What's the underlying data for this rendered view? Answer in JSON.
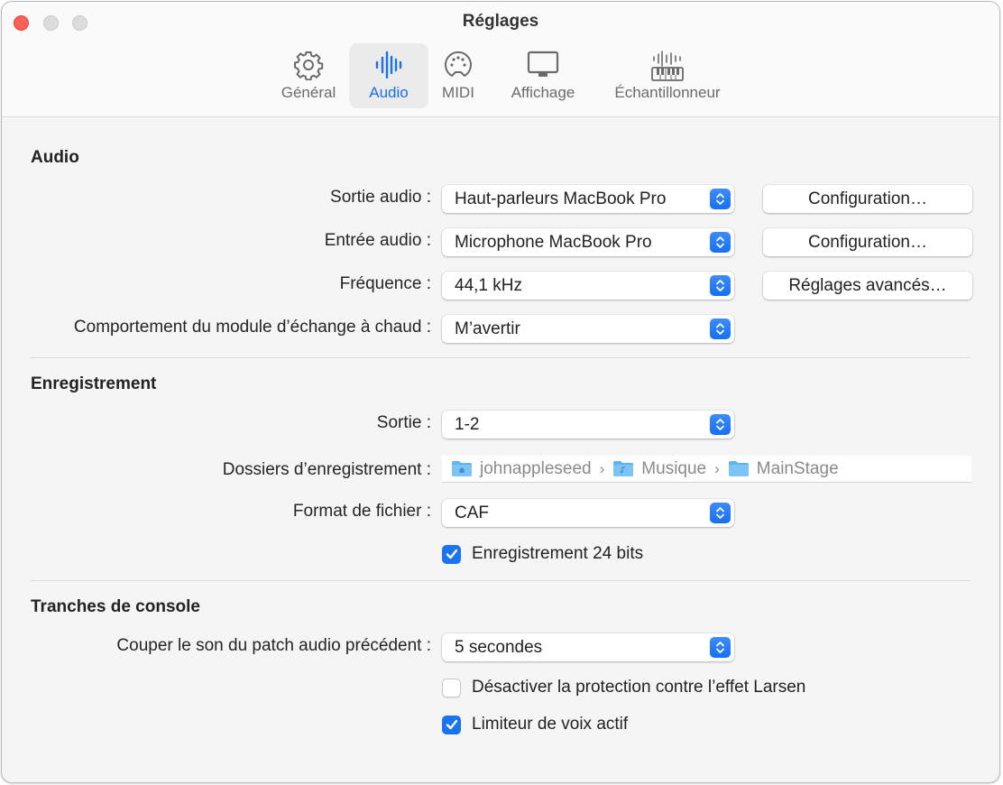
{
  "window": {
    "title": "Réglages",
    "controls": [
      "close",
      "minimize",
      "zoom"
    ]
  },
  "tabs": [
    {
      "label": "Général",
      "icon": "gear-icon",
      "active": false
    },
    {
      "label": "Audio",
      "icon": "waveform-icon",
      "active": true
    },
    {
      "label": "MIDI",
      "icon": "midi-port-icon",
      "active": false
    },
    {
      "label": "Affichage",
      "icon": "display-icon",
      "active": false
    },
    {
      "label": "Échantillonneur",
      "icon": "sampler-keyboard-icon",
      "active": false
    }
  ],
  "accent_color": "#1a73ef",
  "sections": {
    "audio": {
      "title": "Audio",
      "output": {
        "label": "Sortie audio :",
        "value": "Haut-parleurs MacBook Pro",
        "button": "Configuration…"
      },
      "input": {
        "label": "Entrée audio :",
        "value": "Microphone MacBook Pro",
        "button": "Configuration…"
      },
      "frequency": {
        "label": "Fréquence :",
        "value": "44,1 kHz",
        "button": "Réglages avancés…"
      },
      "hotplug": {
        "label": "Comportement du module d’échange à chaud :",
        "value": "M’avertir"
      }
    },
    "recording": {
      "title": "Enregistrement",
      "output": {
        "label": "Sortie :",
        "value": "1-2"
      },
      "folders": {
        "label": "Dossiers d’enregistrement :",
        "path": [
          "johnappleseed",
          "Musique",
          "MainStage"
        ]
      },
      "format": {
        "label": "Format de fichier :",
        "value": "CAF"
      },
      "bit24": {
        "label": "Enregistrement 24 bits",
        "checked": true
      }
    },
    "channel_strips": {
      "title": "Tranches de console",
      "mute": {
        "label": "Couper le son du patch audio précédent :",
        "value": "5 secondes"
      },
      "feedback": {
        "label": "Désactiver la protection contre l’effet Larsen",
        "checked": false
      },
      "limiter": {
        "label": "Limiteur de voix actif",
        "checked": true
      }
    }
  }
}
